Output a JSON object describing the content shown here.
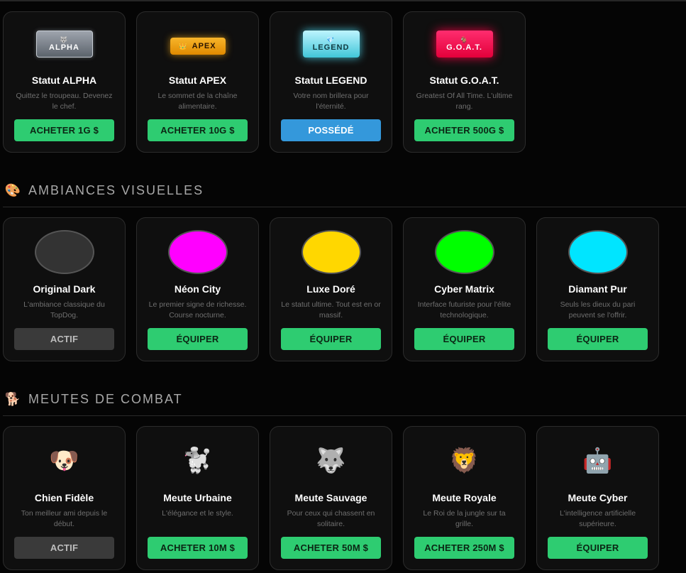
{
  "status_cards": [
    {
      "badge_icon": "🐺",
      "badge": "ALPHA",
      "title": "Statut ALPHA",
      "desc": "Quittez le troupeau. Devenez le chef.",
      "button": "ACHETER 1G $"
    },
    {
      "badge_icon": "👑",
      "badge": "APEX",
      "title": "Statut APEX",
      "desc": "Le sommet de la chaîne alimentaire.",
      "button": "ACHETER 10G $"
    },
    {
      "badge_icon": "💎",
      "badge": "LEGEND",
      "title": "Statut LEGEND",
      "desc": "Votre nom brillera pour l'éternité.",
      "button": "POSSÉDÉ"
    },
    {
      "badge_icon": "🐐",
      "badge": "G.O.A.T.",
      "title": "Statut G.O.A.T.",
      "desc": "Greatest Of All Time. L'ultime rang.",
      "button": "ACHETER 500G $"
    }
  ],
  "themes_section": {
    "icon": "🎨",
    "title": "AMBIANCES VISUELLES"
  },
  "theme_cards": [
    {
      "color": "#333333",
      "title": "Original Dark",
      "desc": "L'ambiance classique du TopDog.",
      "button": "ACTIF"
    },
    {
      "color": "#ff00ff",
      "title": "Néon City",
      "desc": "Le premier signe de richesse. Course nocturne.",
      "button": "ÉQUIPER"
    },
    {
      "color": "#ffd700",
      "title": "Luxe Doré",
      "desc": "Le statut ultime. Tout est en or massif.",
      "button": "ÉQUIPER"
    },
    {
      "color": "#00ff00",
      "title": "Cyber Matrix",
      "desc": "Interface futuriste pour l'élite technologique.",
      "button": "ÉQUIPER"
    },
    {
      "color": "#00e5ff",
      "title": "Diamant Pur",
      "desc": "Seuls les dieux du pari peuvent se l'offrir.",
      "button": "ÉQUIPER"
    }
  ],
  "packs_section": {
    "icon": "🐕",
    "title": "MEUTES DE COMBAT"
  },
  "pack_cards": [
    {
      "icon": "🐶",
      "title": "Chien Fidèle",
      "desc": "Ton meilleur ami depuis le début.",
      "button": "ACTIF"
    },
    {
      "icon": "🐩",
      "title": "Meute Urbaine",
      "desc": "L'élégance et le style.",
      "button": "ACHETER 10M $"
    },
    {
      "icon": "🐺",
      "title": "Meute Sauvage",
      "desc": "Pour ceux qui chassent en solitaire.",
      "button": "ACHETER 50M $"
    },
    {
      "icon": "🦁",
      "title": "Meute Royale",
      "desc": "Le Roi de la jungle sur ta grille.",
      "button": "ACHETER 250M $"
    },
    {
      "icon": "🤖",
      "title": "Meute Cyber",
      "desc": "L'intelligence artificielle supérieure.",
      "button": "ÉQUIPER"
    }
  ],
  "colors": {
    "buy": "#2ecc71",
    "owned": "#3498db",
    "active": "#3a3a3a"
  }
}
